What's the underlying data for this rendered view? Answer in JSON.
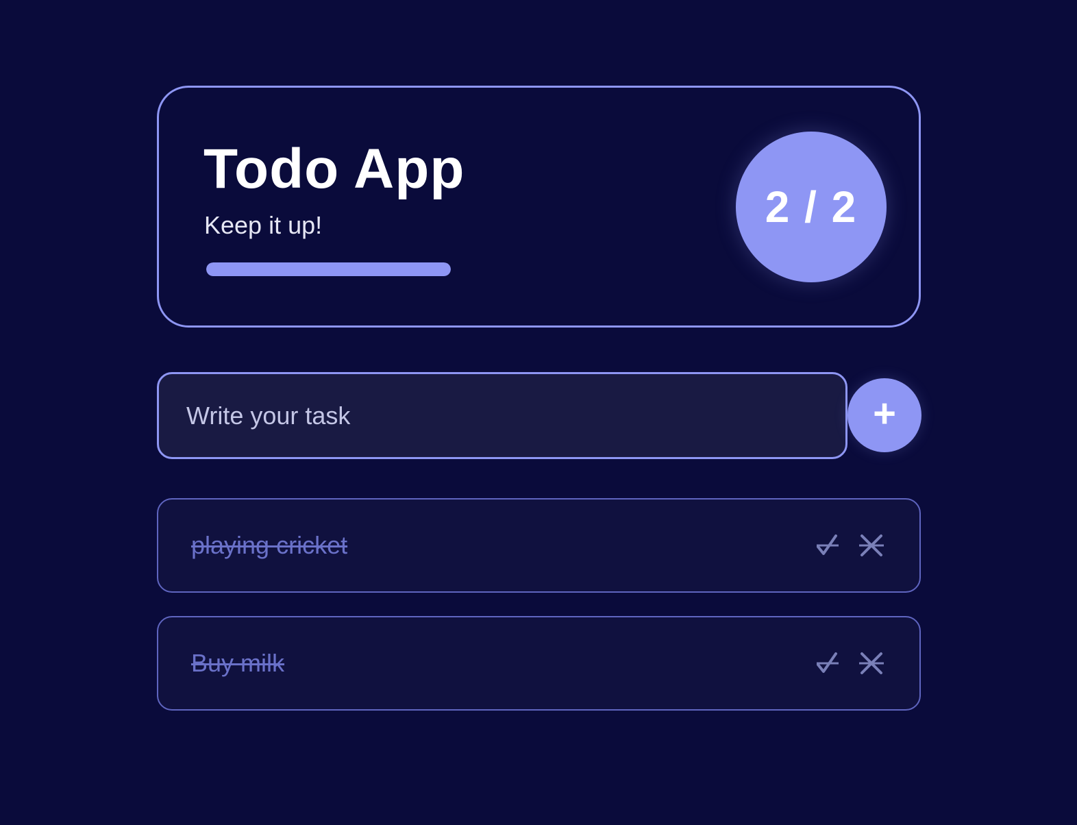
{
  "header": {
    "title": "Todo App",
    "subtitle": "Keep it up!",
    "progress_fraction": 1.0,
    "count_text": "2 / 2"
  },
  "input": {
    "placeholder": "Write your task",
    "add_icon": "plus-icon",
    "add_label": "+"
  },
  "tasks": [
    {
      "text": "playing cricket",
      "completed": true,
      "complete_icon": "check-icon",
      "delete_icon": "close-icon"
    },
    {
      "text": "Buy milk",
      "completed": true,
      "complete_icon": "check-icon",
      "delete_icon": "close-icon"
    }
  ],
  "colors": {
    "background": "#0a0b3b",
    "accent": "#8e96f4",
    "completed_text": "#6a71c9",
    "icon": "#7a80b8"
  }
}
